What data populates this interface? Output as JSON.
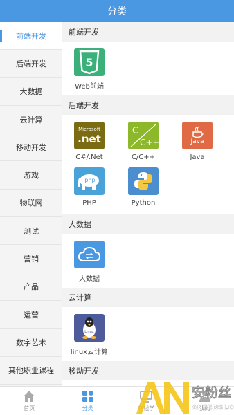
{
  "header": {
    "title": "分类"
  },
  "sidebar": {
    "items": [
      {
        "label": "前端开发"
      },
      {
        "label": "后端开发"
      },
      {
        "label": "大数据"
      },
      {
        "label": "云计算"
      },
      {
        "label": "移动开发"
      },
      {
        "label": "游戏"
      },
      {
        "label": "物联网"
      },
      {
        "label": "测试"
      },
      {
        "label": "营销"
      },
      {
        "label": "产品"
      },
      {
        "label": "运营"
      },
      {
        "label": "数字艺术"
      },
      {
        "label": "其他职业课程"
      }
    ]
  },
  "sections": [
    {
      "title": "前端开发",
      "tiles": [
        {
          "label": "Web前端",
          "icon": "html5-icon",
          "glyph": "5",
          "color": "#3cb07a"
        }
      ]
    },
    {
      "title": "后端开发",
      "tiles": [
        {
          "label": "C#/.Net",
          "icon": "dotnet-icon",
          "glyph": ".net",
          "brand": "Microsoft",
          "color": "#7b6b12"
        },
        {
          "label": "C/C++",
          "icon": "cpp-icon",
          "glyph": "C / C++",
          "color": "#8cb82a"
        },
        {
          "label": "Java",
          "icon": "java-icon",
          "glyph": "Java",
          "color": "#e06a43"
        },
        {
          "label": "PHP",
          "icon": "php-elephant-icon",
          "glyph": "php",
          "color": "#4aa3d8"
        },
        {
          "label": "Python",
          "icon": "python-icon",
          "glyph": "",
          "color": "#4a8ed0"
        }
      ]
    },
    {
      "title": "大数据",
      "tiles": [
        {
          "label": "大数据",
          "icon": "cloud-sync-icon",
          "glyph": "",
          "color": "#4a97e2"
        }
      ]
    },
    {
      "title": "云计算",
      "tiles": [
        {
          "label": "linux云计算",
          "icon": "linux-penguin-icon",
          "glyph": "Linux",
          "color": "#4d5b9a"
        }
      ]
    },
    {
      "title": "移动开发",
      "tiles": []
    }
  ],
  "bottom_nav": [
    {
      "label": "首页",
      "icon": "home-icon",
      "active": false
    },
    {
      "label": "分类",
      "icon": "category-icon",
      "active": true
    },
    {
      "label": "在线学",
      "icon": "online-study-icon",
      "active": false
    },
    {
      "label": "我的",
      "icon": "profile-icon",
      "active": false
    }
  ],
  "watermark": {
    "big": "AN",
    "cn": "安粉丝",
    "url": "ANFENSI.COM"
  },
  "colors": {
    "accent": "#4a97e2",
    "header_bg": "#4a97e2"
  }
}
